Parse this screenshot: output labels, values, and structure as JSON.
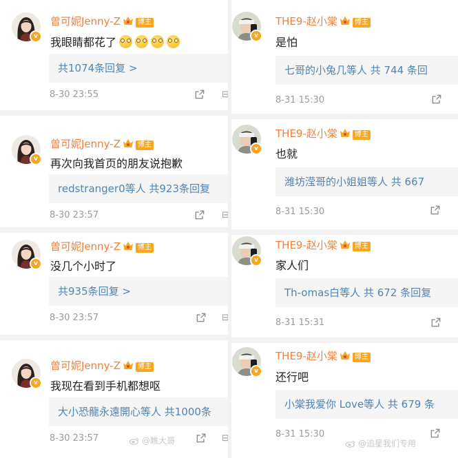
{
  "left": {
    "author": "曾可妮Jenny-Z",
    "author_tag": "博主",
    "posts": [
      {
        "text": "我眼睛都花了",
        "emojis": 4,
        "reply": "共1074条回复 >",
        "time": "8-30 23:55"
      },
      {
        "text": "再次向我首页的朋友说抱歉",
        "emojis": 0,
        "reply": "redstranger0等人  共923条回复",
        "time": "8-30 23:57"
      },
      {
        "text": "没几个小时了",
        "emojis": 0,
        "reply": "共935条回复 >",
        "time": "8-30 23:57"
      },
      {
        "text": "我现在看到手机都想呕",
        "emojis": 0,
        "reply": "大小恐龍永遠開心等人  共1000条",
        "time": "8-30 23:57"
      }
    ]
  },
  "right": {
    "author": "THE9-赵小棠",
    "author_tag": "博主",
    "posts": [
      {
        "text": "是怕",
        "reply": "七哥的小兔几等人  共 744 条回",
        "time": "8-31 15:30"
      },
      {
        "text": "也就",
        "reply": "潍坊滢哥的小姐姐等人  共 667",
        "time": "8-31 15:30"
      },
      {
        "text": "家人们",
        "reply": "Th-omas白等人  共 672 条回复",
        "time": "8-31 15:31"
      },
      {
        "text": "还行吧",
        "reply": "小棠我爱你 Love等人  共 679 条",
        "time": "8-31 15:30"
      }
    ]
  },
  "watermarks": {
    "left": "@瞧大哥",
    "right": "@追星我们专用"
  },
  "icons": {
    "share": "share-icon",
    "more": "more-icon",
    "crown": "crown-icon",
    "verified": "verified-badge-icon",
    "emoji": "dizzy-emoji-icon",
    "weibo": "weibo-logo-icon"
  },
  "colors": {
    "name": "#f2803a",
    "reply_link": "#4f84b7",
    "reply_bg": "#f5f5f5",
    "meta": "#9a9a9a",
    "badge": "#f6a623"
  }
}
